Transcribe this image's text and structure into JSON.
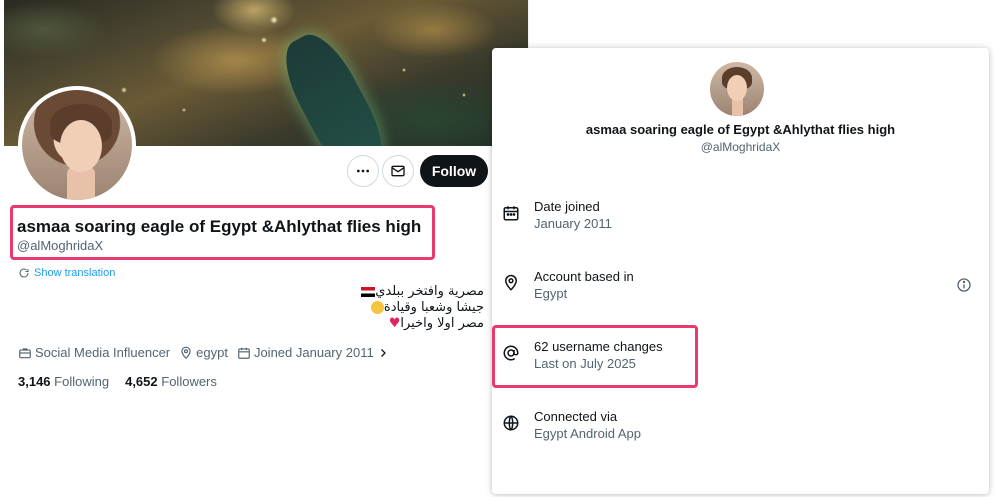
{
  "profile": {
    "name": "asmaa soaring eagle of Egypt &Ahlythat flies high",
    "handle": "@alMoghridaX",
    "follow_label": "Follow",
    "show_translation": "Show translation",
    "bio_lines": [
      "مصرية وافتخر ببلدي",
      "جيشا وشعبا وقيادة",
      "مصر اولا واخيرا"
    ],
    "category": "Social Media Influencer",
    "location": "egypt",
    "joined": "Joined January 2011",
    "following_count": "3,146",
    "following_label": "Following",
    "followers_count": "4,652",
    "followers_label": "Followers"
  },
  "about": {
    "name": "asmaa soaring eagle of Egypt &Ahlythat flies high",
    "handle": "@alMoghridaX",
    "rows": [
      {
        "title": "Date joined",
        "sub": "January 2011",
        "icon": "calendar-icon"
      },
      {
        "title": "Account based in",
        "sub": "Egypt",
        "icon": "location-pin-icon"
      },
      {
        "title": "62 username changes",
        "sub": "Last on July 2025",
        "icon": "at-sign-icon"
      },
      {
        "title": "Connected via",
        "sub": "Egypt Android App",
        "icon": "globe-icon"
      }
    ]
  },
  "colors": {
    "highlight": "#e83a6d",
    "link": "#1d9bf0",
    "text_primary": "#0f1419",
    "text_secondary": "#536471"
  }
}
